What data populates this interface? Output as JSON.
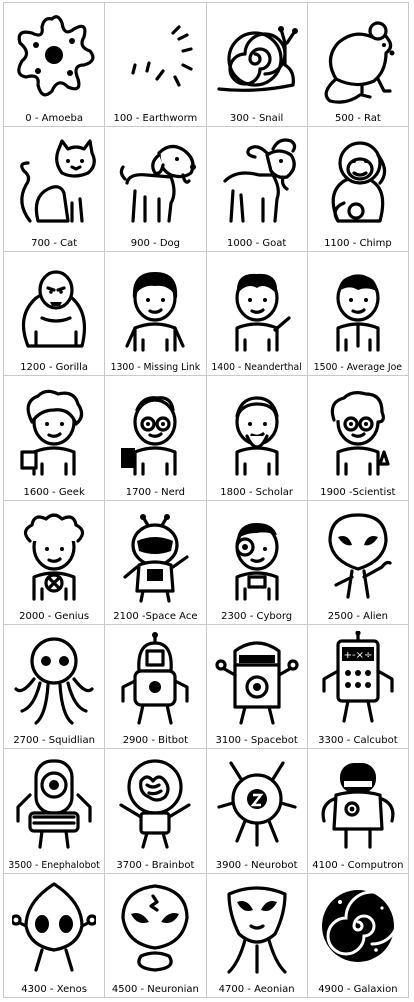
{
  "creatures": [
    {
      "label": "0 - Amoeba",
      "icon": "amoeba-icon"
    },
    {
      "label": "100 - Earthworm",
      "icon": "earthworm-icon"
    },
    {
      "label": "300 - Snail",
      "icon": "snail-icon"
    },
    {
      "label": "500 - Rat",
      "icon": "rat-icon"
    },
    {
      "label": "700 - Cat",
      "icon": "cat-icon"
    },
    {
      "label": "900 - Dog",
      "icon": "dog-icon"
    },
    {
      "label": "1000 - Goat",
      "icon": "goat-icon"
    },
    {
      "label": "1100 - Chimp",
      "icon": "chimp-icon"
    },
    {
      "label": "1200 - Gorilla",
      "icon": "gorilla-icon"
    },
    {
      "label": "1300 - Missing Link",
      "icon": "missing-link-icon"
    },
    {
      "label": "1400 - Neanderthal",
      "icon": "neanderthal-icon"
    },
    {
      "label": "1500 - Average Joe",
      "icon": "average-joe-icon"
    },
    {
      "label": "1600 - Geek",
      "icon": "geek-icon"
    },
    {
      "label": "1700 - Nerd",
      "icon": "nerd-icon"
    },
    {
      "label": "1800 - Scholar",
      "icon": "scholar-icon"
    },
    {
      "label": "1900 -Scientist",
      "icon": "scientist-icon"
    },
    {
      "label": "2000 - Genius",
      "icon": "genius-icon"
    },
    {
      "label": "2100 -Space Ace",
      "icon": "space-ace-icon"
    },
    {
      "label": "2300 - Cyborg",
      "icon": "cyborg-icon"
    },
    {
      "label": "2500 - Alien",
      "icon": "alien-icon"
    },
    {
      "label": "2700 - Squidlian",
      "icon": "squidlian-icon"
    },
    {
      "label": "2900 -  Bitbot",
      "icon": "bitbot-icon"
    },
    {
      "label": "3100 - Spacebot",
      "icon": "spacebot-icon"
    },
    {
      "label": "3300 - Calcubot",
      "icon": "calcubot-icon"
    },
    {
      "label": "3500 - Enephalobot",
      "icon": "enephalobot-icon"
    },
    {
      "label": "3700 - Brainbot",
      "icon": "brainbot-icon"
    },
    {
      "label": "3900 - Neurobot",
      "icon": "neurobot-icon"
    },
    {
      "label": "4100 - Computron",
      "icon": "computron-icon"
    },
    {
      "label": "4300 - Xenos",
      "icon": "xenos-icon"
    },
    {
      "label": "4500 - Neuronian",
      "icon": "neuronian-icon"
    },
    {
      "label": "4700 - Aeonian",
      "icon": "aeonian-icon"
    },
    {
      "label": "4900 - Galaxion",
      "icon": "galaxion-icon"
    }
  ],
  "calcubot_screen": "+-×÷"
}
